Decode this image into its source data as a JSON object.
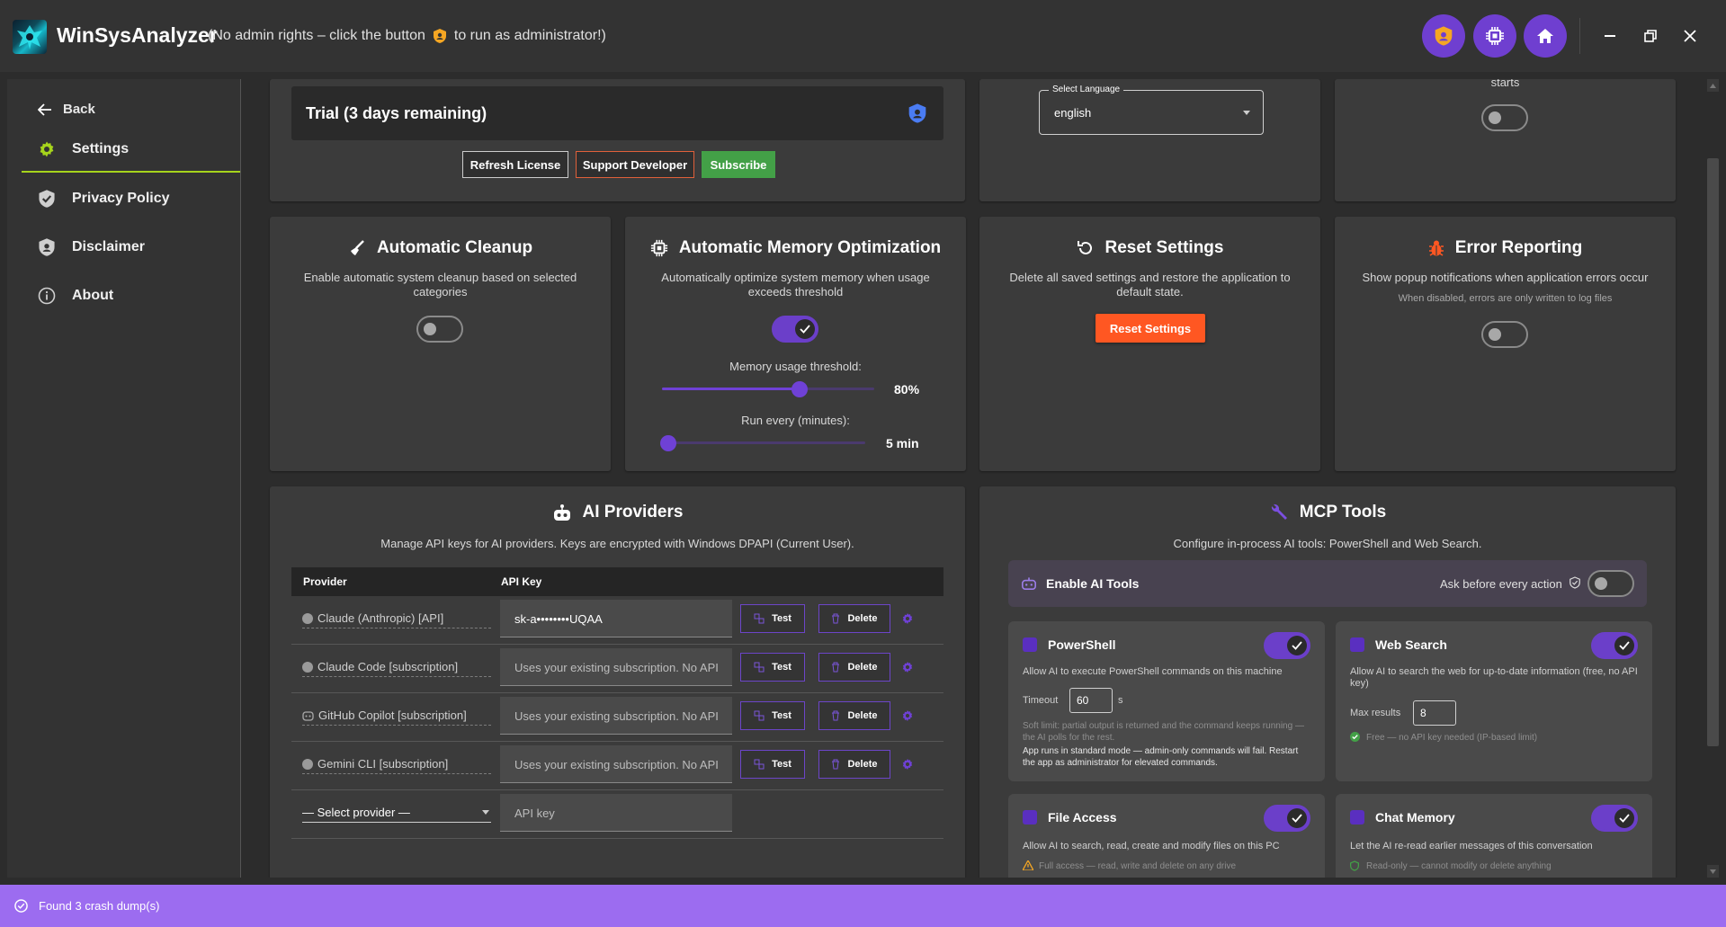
{
  "app": {
    "name": "WinSysAnalyzer",
    "admin_note_before": "(No admin rights – click the button",
    "admin_note_after": "to run as administrator!)"
  },
  "sidebar": {
    "back_label": "Back",
    "items": [
      {
        "label": "Settings",
        "icon": "gear-icon",
        "active": true
      },
      {
        "label": "Privacy Policy",
        "icon": "shield-check-icon",
        "active": false
      },
      {
        "label": "Disclaimer",
        "icon": "shield-person-icon",
        "active": false
      },
      {
        "label": "About",
        "icon": "info-icon",
        "active": false
      }
    ]
  },
  "license": {
    "status": "Trial (3 days remaining)",
    "refresh_label": "Refresh License",
    "support_label": "Support Developer",
    "subscribe_label": "Subscribe"
  },
  "language": {
    "field_label": "Select Language",
    "value": "english"
  },
  "startup": {
    "partial_text": "starts",
    "enabled": false
  },
  "cleanup": {
    "title": "Automatic Cleanup",
    "description": "Enable automatic system cleanup based on selected categories",
    "enabled": false
  },
  "memory": {
    "title": "Automatic Memory Optimization",
    "description": "Automatically optimize system memory when usage exceeds threshold",
    "enabled": true,
    "threshold_label": "Memory usage threshold:",
    "threshold_value": "80%",
    "threshold_fraction": 0.65,
    "interval_label": "Run every (minutes):",
    "interval_value": "5 min",
    "interval_fraction": 0.0
  },
  "reset": {
    "title": "Reset Settings",
    "description": "Delete all saved settings and restore the application to default state.",
    "button_label": "Reset Settings"
  },
  "error_reporting": {
    "title": "Error Reporting",
    "description": "Show popup notifications when application errors occur",
    "note": "When disabled, errors are only written to log files",
    "enabled": false
  },
  "ai_providers": {
    "title": "AI Providers",
    "description": "Manage API keys for AI providers. Keys are encrypted with Windows DPAPI (Current User).",
    "columns": [
      "Provider",
      "API Key"
    ],
    "rows": [
      {
        "provider": "Claude (Anthropic) [API]",
        "key": "sk-a••••••••UQAA",
        "test": "Test",
        "delete": "Delete"
      },
      {
        "provider": "Claude Code [subscription]",
        "key": "Uses your existing subscription. No API",
        "test": "Test",
        "delete": "Delete"
      },
      {
        "provider": "GitHub Copilot [subscription]",
        "key": "Uses your existing subscription. No API",
        "test": "Test",
        "delete": "Delete"
      },
      {
        "provider": "Gemini CLI [subscription]",
        "key": "Uses your existing subscription. No API",
        "test": "Test",
        "delete": "Delete"
      }
    ],
    "new_provider_placeholder": "— Select provider —",
    "new_key_placeholder": "API key"
  },
  "mcp": {
    "title": "MCP Tools",
    "description": "Configure in-process AI tools: PowerShell and Web Search.",
    "enable_label": "Enable AI Tools",
    "ask_label": "Ask before every action",
    "enable_on": false,
    "powershell": {
      "title": "PowerShell",
      "description": "Allow AI to execute PowerShell commands on this machine",
      "timeout_label": "Timeout",
      "timeout_value": "60",
      "timeout_unit": "s",
      "soft_limit": "Soft limit: partial output is returned and the command keeps running — the AI polls for the rest.",
      "mode_note": "App runs in standard mode — admin-only commands will fail. Restart the app as administrator for elevated commands."
    },
    "websearch": {
      "title": "Web Search",
      "description": "Allow AI to search the web for up-to-date information (free, no API key)",
      "max_label": "Max results",
      "max_value": "8",
      "free_note": "Free — no API key needed (IP-based limit)"
    },
    "fileaccess": {
      "title": "File Access",
      "description": "Allow AI to search, read, create and modify files on this PC",
      "note": "Full access — read, write and delete on any drive"
    },
    "chatmemory": {
      "title": "Chat Memory",
      "description": "Let the AI re-read earlier messages of this conversation",
      "note": "Read-only — cannot modify or delete anything"
    }
  },
  "status": {
    "message": "Found 3 crash dump(s)"
  },
  "colors": {
    "accent": "#6f3fd0",
    "status_bar": "#9c6cf0",
    "subscribe": "#43a047",
    "reset": "#ff5722",
    "active_underline": "#a6d41c"
  }
}
